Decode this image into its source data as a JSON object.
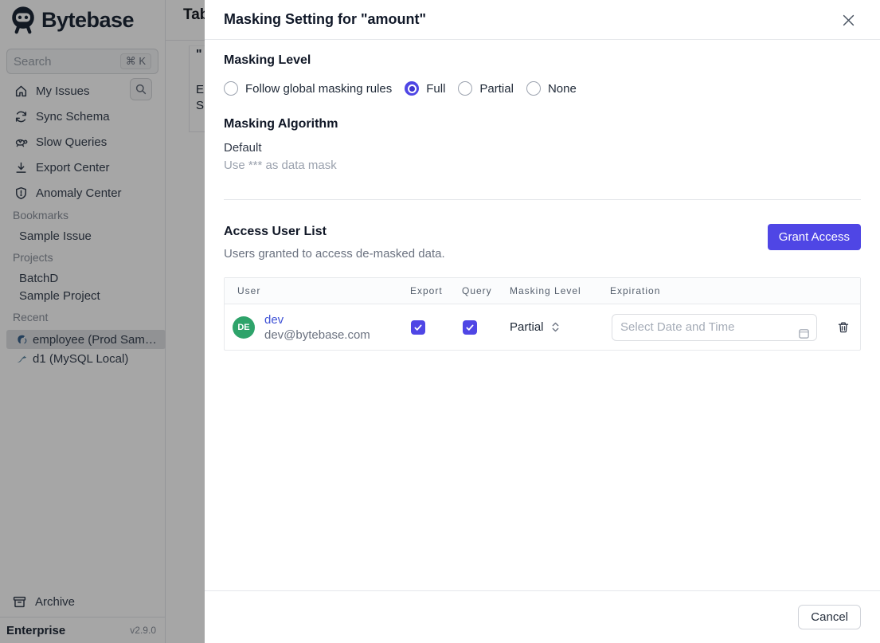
{
  "colors": {
    "accent": "#4f46e5",
    "avatar_green": "#2ea36a",
    "link_blue": "#4053d6",
    "overlay": "rgba(0,0,0,0.35)"
  },
  "sidebar": {
    "logo": "Bytebase",
    "search": {
      "placeholder": "Search",
      "shortcut": "⌘ K"
    },
    "nav": [
      {
        "label": "My Issues",
        "icon": "home-icon"
      },
      {
        "label": "Sync Schema",
        "icon": "sync-icon"
      },
      {
        "label": "Slow Queries",
        "icon": "turtle-icon"
      },
      {
        "label": "Export Center",
        "icon": "download-icon"
      },
      {
        "label": "Anomaly Center",
        "icon": "shield-icon"
      }
    ],
    "bookmarks": {
      "title": "Bookmarks",
      "items": [
        "Sample Issue"
      ]
    },
    "projects": {
      "title": "Projects",
      "items": [
        "BatchD",
        "Sample Project"
      ]
    },
    "recent": {
      "title": "Recent",
      "items": [
        {
          "label": "employee (Prod Sam…",
          "icon": "postgres-icon",
          "selected": true
        },
        {
          "label": "d1 (MySQL Local)",
          "icon": "mysql-icon",
          "selected": false
        }
      ]
    },
    "archive": "Archive",
    "plan": "Enterprise",
    "version": "v2.9.0"
  },
  "background_page": {
    "heading_fragment": "Tab",
    "quote_fragment": "\"",
    "row_fragments": [
      "E",
      "S"
    ]
  },
  "modal": {
    "title": "Masking Setting for \"amount\"",
    "masking_level": {
      "heading": "Masking Level",
      "options": [
        {
          "label": "Follow global masking rules",
          "selected": false
        },
        {
          "label": "Full",
          "selected": true
        },
        {
          "label": "Partial",
          "selected": false
        },
        {
          "label": "None",
          "selected": false
        }
      ]
    },
    "masking_algorithm": {
      "heading": "Masking Algorithm",
      "name": "Default",
      "description": "Use *** as data mask"
    },
    "access": {
      "heading": "Access User List",
      "subtitle": "Users granted to access de-masked data.",
      "grant_button": "Grant Access"
    },
    "table": {
      "columns": [
        "User",
        "Export",
        "Query",
        "Masking Level",
        "Expiration"
      ],
      "rows": [
        {
          "initials": "DE",
          "name": "dev",
          "email": "dev@bytebase.com",
          "export_checked": true,
          "query_checked": true,
          "masking_level": "Partial",
          "expiration_value": "",
          "expiration_placeholder": "Select Date and Time"
        }
      ]
    },
    "footer": {
      "cancel": "Cancel"
    }
  }
}
